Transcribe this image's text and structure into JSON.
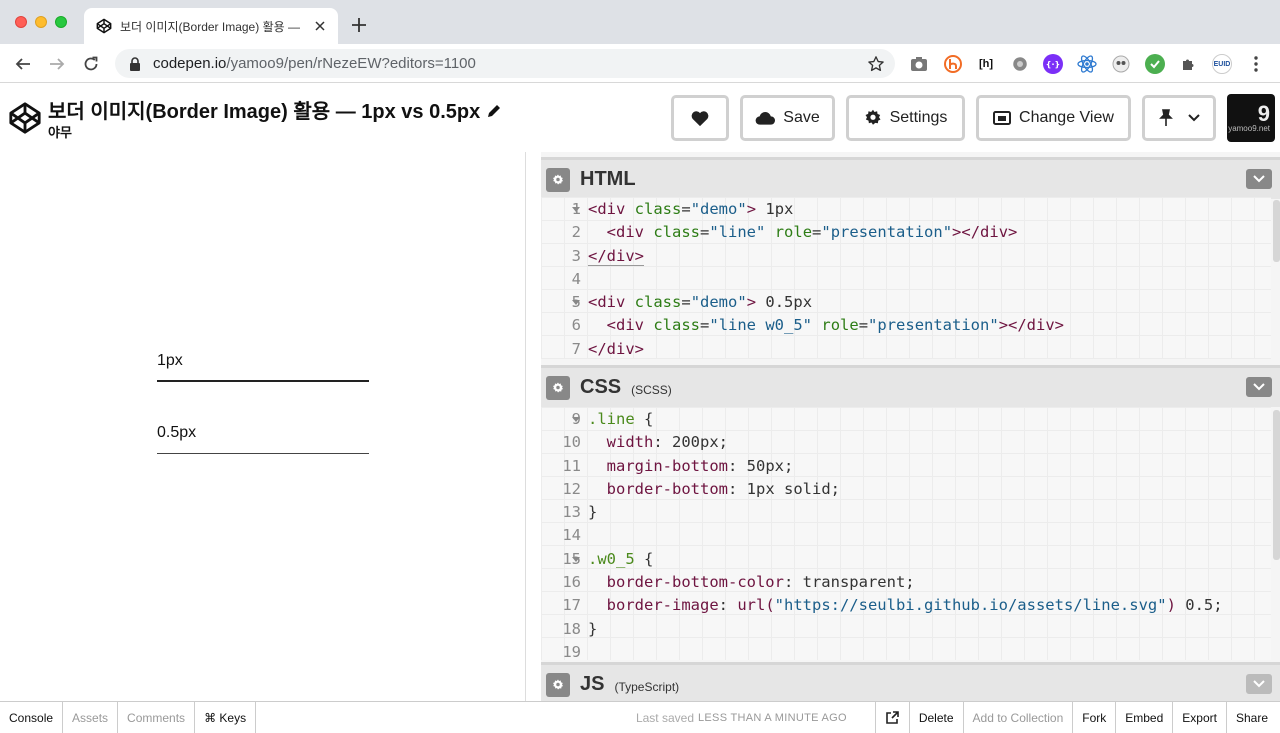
{
  "browser": {
    "tab_title": "보더 이미지(Border Image) 활용 —",
    "url_host": "codepen.io",
    "url_path": "/yamoo9/pen/rNezeEW?editors=1100",
    "extensions": [
      "camera-icon",
      "honey-icon",
      "hackernews-icon",
      "gear-icon",
      "purple-ext-icon",
      "react-devtools-icon",
      "owl-icon",
      "shield-icon",
      "puzzle-icon",
      "euid-icon"
    ],
    "euid_label": "EUID"
  },
  "header": {
    "title": "보더 이미지(Border Image) 활용 — 1px vs 0.5px",
    "author": "야무",
    "save_label": "Save",
    "settings_label": "Settings",
    "change_view_label": "Change View",
    "avatar_number": "9",
    "avatar_text": "yamoo9.net"
  },
  "preview": {
    "demo1_label": "1px",
    "demo2_label": "0.5px"
  },
  "editors": {
    "html": {
      "title": "HTML",
      "sub": ""
    },
    "css": {
      "title": "CSS",
      "sub": "(SCSS)"
    },
    "js": {
      "title": "JS",
      "sub": "(TypeScript)"
    }
  },
  "footer": {
    "console": "Console",
    "assets": "Assets",
    "comments": "Comments",
    "keys": "⌘ Keys",
    "saved_prefix": "Last saved",
    "saved_time": "LESS THAN A MINUTE ago",
    "delete": "Delete",
    "add_to_collection": "Add to Collection",
    "fork": "Fork",
    "embed": "Embed",
    "export": "Export",
    "share": "Share"
  },
  "colors": {
    "tag": "#6e1440",
    "attr": "#2e7d16",
    "string": "#1b5e8a",
    "selector": "#4b8a1c"
  }
}
